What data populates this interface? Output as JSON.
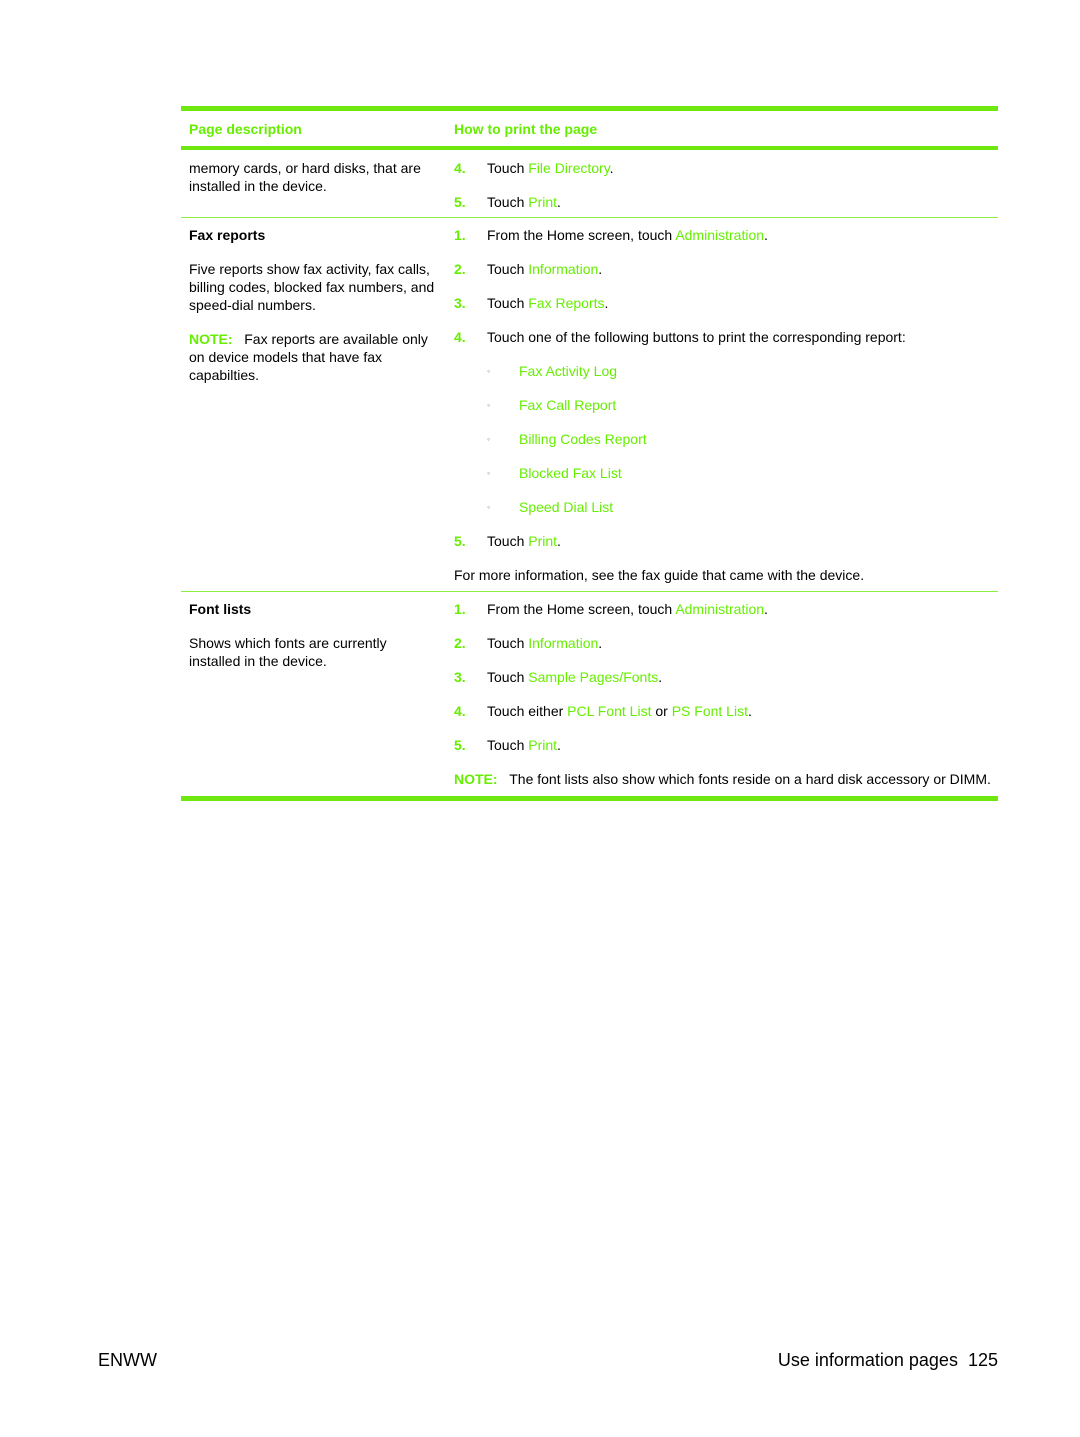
{
  "table": {
    "headers": [
      "Page description",
      "How to print the page"
    ],
    "continued_row": {
      "description": "memory cards, or hard disks, that are installed in the device.",
      "steps": [
        {
          "num": "4.",
          "text": "Touch ",
          "link": "File Directory",
          "suffix": "."
        },
        {
          "num": "5.",
          "text": "Touch ",
          "link": "Print",
          "suffix": "."
        }
      ]
    },
    "fax_row": {
      "title": "Fax reports",
      "description": "Five reports show fax activity, fax calls, billing codes, blocked fax numbers, and speed-dial numbers.",
      "note_label": "NOTE:",
      "note_text": "Fax reports are available only on device models that have fax capabilties.",
      "steps": [
        {
          "num": "1.",
          "text": "From the Home screen, touch ",
          "link": "Administration",
          "suffix": "."
        },
        {
          "num": "2.",
          "text": "Touch ",
          "link": "Information",
          "suffix": "."
        },
        {
          "num": "3.",
          "text": "Touch ",
          "link": "Fax Reports",
          "suffix": "."
        },
        {
          "num": "4.",
          "text": "Touch one of the following buttons to print the corresponding report:"
        }
      ],
      "bullets": [
        "Fax Activity Log",
        "Fax Call Report",
        "Billing Codes Report",
        "Blocked Fax List",
        "Speed Dial List"
      ],
      "step5": {
        "num": "5.",
        "text": "Touch ",
        "link": "Print",
        "suffix": "."
      },
      "more_info": "For more information, see the fax guide that came with the device."
    },
    "font_row": {
      "title": "Font lists",
      "description": "Shows which fonts are currently installed in the device.",
      "steps": [
        {
          "num": "1.",
          "text": "From the Home screen, touch ",
          "link": "Administration",
          "suffix": "."
        },
        {
          "num": "2.",
          "text": "Touch ",
          "link": "Information",
          "suffix": "."
        },
        {
          "num": "3.",
          "text": "Touch ",
          "link": "Sample Pages/Fonts",
          "suffix": "."
        }
      ],
      "step4": {
        "num": "4.",
        "text": "Touch either ",
        "link1": "PCL Font List",
        "mid": " or ",
        "link2": "PS Font List",
        "suffix": "."
      },
      "step5": {
        "num": "5.",
        "text": "Touch ",
        "link": "Print",
        "suffix": "."
      },
      "note_label": "NOTE:",
      "note_text": "The font lists also show which fonts reside on a hard disk accessory or DIMM."
    }
  },
  "footer": {
    "left": "ENWW",
    "section": "Use information pages",
    "page": "125"
  }
}
